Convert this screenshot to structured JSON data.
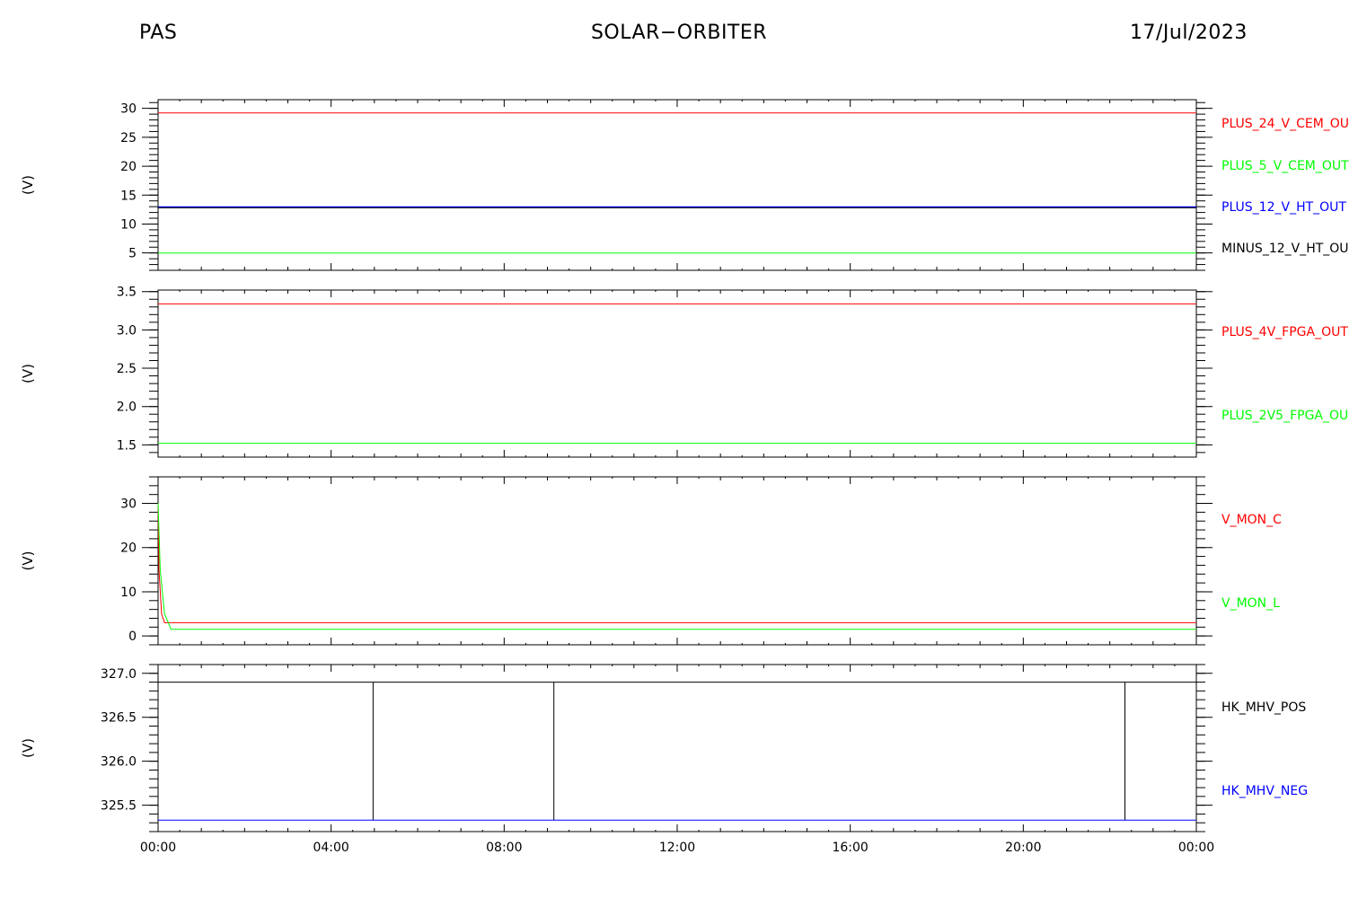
{
  "header": {
    "left": "PAS",
    "center": "SOLAR−ORBITER",
    "right": "17/Jul/2023"
  },
  "x_tick_labels": [
    "00:00",
    "04:00",
    "08:00",
    "12:00",
    "16:00",
    "20:00",
    "00:00"
  ],
  "chart_data": [
    {
      "type": "line",
      "ylabel": "(V)",
      "ylim": [
        2,
        31.5
      ],
      "yticks": [
        5,
        10,
        15,
        20,
        25,
        30
      ],
      "ytick_labels": [
        "5",
        "10",
        "15",
        "20",
        "25",
        "30"
      ],
      "xlim": [
        0,
        24
      ],
      "series": [
        {
          "name": "PLUS_24_V_CEM_OU",
          "color": "#ff0000",
          "x": [
            0,
            24
          ],
          "y": [
            29.2,
            29.2
          ]
        },
        {
          "name": "PLUS_5_V_CEM_OUT",
          "color": "#00ff00",
          "x": [
            0,
            24
          ],
          "y": [
            5.0,
            5.0
          ]
        },
        {
          "name": "PLUS_12_V_HT_OUT",
          "color": "#0000ff",
          "x": [
            0,
            24
          ],
          "y": [
            12.9,
            12.9
          ]
        },
        {
          "name": "MINUS_12_V_HT_OU",
          "color": "#000000",
          "x": [
            0,
            24
          ],
          "y": [
            12.8,
            12.8
          ]
        }
      ]
    },
    {
      "type": "line",
      "ylabel": "(V)",
      "ylim": [
        1.34,
        3.52
      ],
      "yticks": [
        1.5,
        2.0,
        2.5,
        3.0,
        3.5
      ],
      "ytick_labels": [
        "1.5",
        "2.0",
        "2.5",
        "3.0",
        "3.5"
      ],
      "xlim": [
        0,
        24
      ],
      "series": [
        {
          "name": "PLUS_4V_FPGA_OUT",
          "color": "#ff0000",
          "x": [
            0,
            24
          ],
          "y": [
            3.34,
            3.34
          ]
        },
        {
          "name": "PLUS_2V5_FPGA_OU",
          "color": "#00ff00",
          "x": [
            0,
            24
          ],
          "y": [
            1.52,
            1.52
          ]
        }
      ]
    },
    {
      "type": "line",
      "ylabel": "(V)",
      "ylim": [
        -2,
        36
      ],
      "yticks": [
        0,
        10,
        20,
        30
      ],
      "ytick_labels": [
        "0",
        "10",
        "20",
        "30"
      ],
      "xlim": [
        0,
        24
      ],
      "series": [
        {
          "name": "V_MON_C",
          "color": "#ff0000",
          "x": [
            0,
            0.02,
            0.08,
            0.15,
            24
          ],
          "y": [
            30,
            15,
            5,
            3,
            3
          ]
        },
        {
          "name": "V_MON_L",
          "color": "#00ff00",
          "x": [
            0,
            0.05,
            0.15,
            0.3,
            24
          ],
          "y": [
            30,
            15,
            5,
            1.5,
            1.5
          ]
        }
      ]
    },
    {
      "type": "line",
      "ylabel": "(V)",
      "ylim": [
        325.2,
        327.1
      ],
      "yticks": [
        325.5,
        326.0,
        326.5,
        327.0
      ],
      "ytick_labels": [
        "325.5",
        "326.0",
        "326.5",
        "327.0"
      ],
      "xlim": [
        0,
        24
      ],
      "series": [
        {
          "name": "HK_MHV_POS",
          "color": "#000000",
          "x": [
            0,
            4.97,
            4.97,
            4.97,
            9.15,
            9.15,
            9.15,
            22.35,
            22.35,
            22.35,
            24
          ],
          "y": [
            326.9,
            326.9,
            325.33,
            326.9,
            326.9,
            325.33,
            326.9,
            326.9,
            325.33,
            326.9,
            326.9
          ]
        },
        {
          "name": "HK_MHV_NEG",
          "color": "#0000ff",
          "x": [
            0,
            24
          ],
          "y": [
            325.33,
            325.33
          ]
        }
      ]
    }
  ]
}
